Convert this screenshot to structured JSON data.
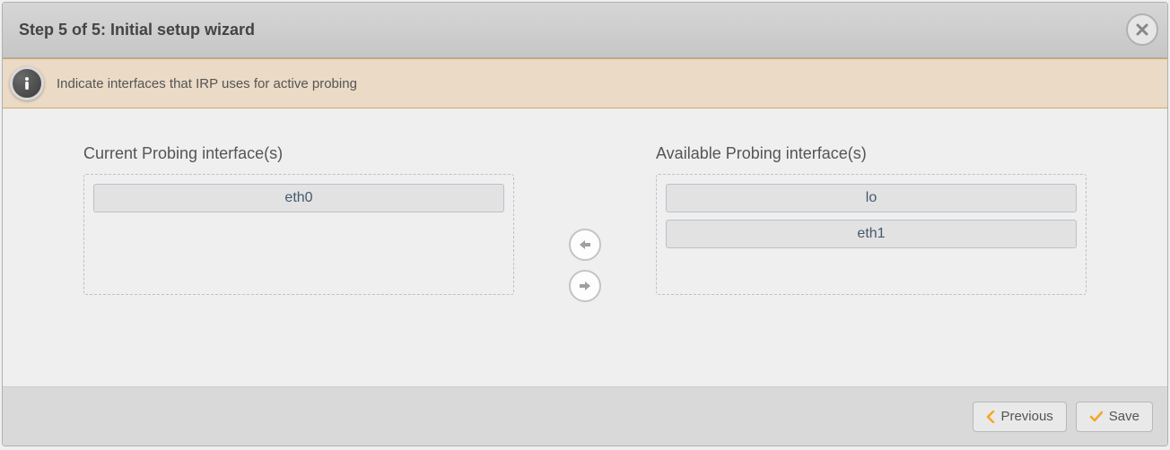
{
  "header": {
    "title": "Step 5 of 5: Initial setup wizard"
  },
  "info": {
    "message": "Indicate interfaces that IRP uses for active probing"
  },
  "panels": {
    "current": {
      "title": "Current Probing interface(s)",
      "items": [
        "eth0"
      ]
    },
    "available": {
      "title": "Available Probing interface(s)",
      "items": [
        "lo",
        "eth1"
      ]
    }
  },
  "footer": {
    "previous_label": "Previous",
    "save_label": "Save"
  }
}
